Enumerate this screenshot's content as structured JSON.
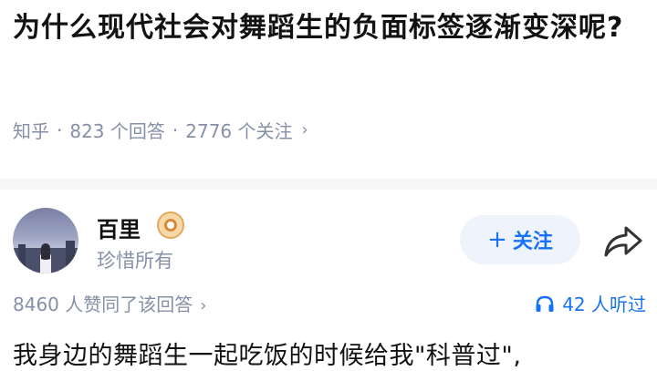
{
  "question": {
    "title": "为什么现代社会对舞蹈生的负面标签逐渐变深呢?",
    "source": "知乎",
    "answers": "823 个回答",
    "followers": "2776 个关注"
  },
  "author": {
    "name": "百里",
    "subtitle": "珍惜所有",
    "badge_icon": "medal-icon",
    "follow_label": "+ 关注",
    "follow_plus": "+",
    "follow_text": "关注"
  },
  "stats": {
    "upvotes": "8460 人赞同了该回答",
    "listeners": "42 人听过"
  },
  "answer": {
    "preview": "我身边的舞蹈生一起吃饭的时候给我\"科普过\","
  },
  "colors": {
    "accent": "#1772f6",
    "meta": "#8590a6",
    "follow_bg": "#eef3fc"
  }
}
